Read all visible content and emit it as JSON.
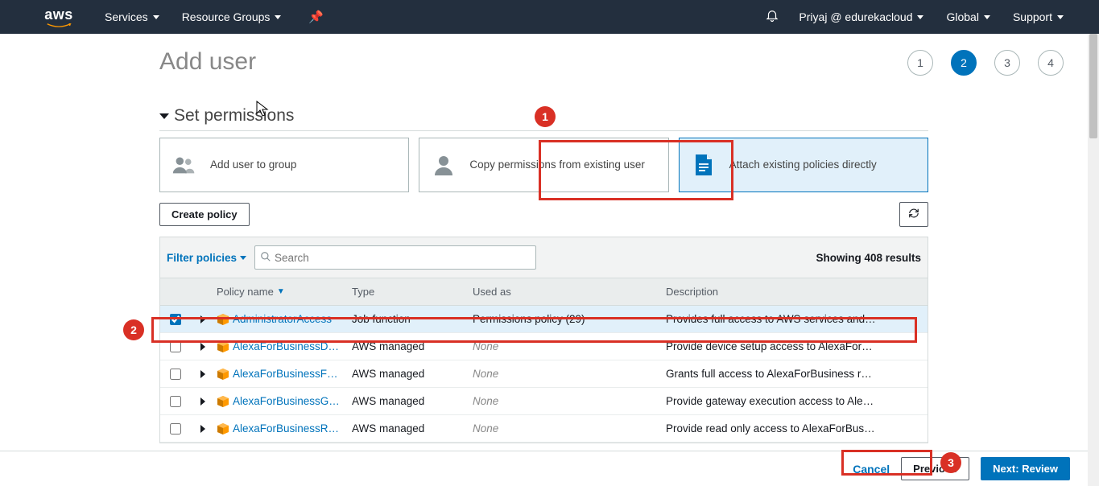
{
  "nav": {
    "services": "Services",
    "resource_groups": "Resource Groups",
    "account": "Priyaj @ edurekacloud",
    "region": "Global",
    "support": "Support"
  },
  "page": {
    "title": "Add user",
    "steps": [
      "1",
      "2",
      "3",
      "4"
    ],
    "active_step": 1
  },
  "section": {
    "title": "Set permissions"
  },
  "options": {
    "add_to_group": "Add user to group",
    "copy": "Copy permissions from existing user",
    "attach": "Attach existing policies directly"
  },
  "buttons": {
    "create_policy": "Create policy",
    "cancel": "Cancel",
    "previous": "Previous",
    "next": "Next: Review"
  },
  "filter": {
    "label": "Filter policies",
    "search_placeholder": "Search",
    "results": "Showing 408 results"
  },
  "columns": {
    "name": "Policy name",
    "type": "Type",
    "used": "Used as",
    "desc": "Description"
  },
  "rows": [
    {
      "checked": true,
      "name": "AdministratorAccess",
      "type": "Job function",
      "used": "Permissions policy (29)",
      "used_none": false,
      "desc": "Provides full access to AWS services and…"
    },
    {
      "checked": false,
      "name": "AlexaForBusinessD…",
      "type": "AWS managed",
      "used": "None",
      "used_none": true,
      "desc": "Provide device setup access to AlexaFor…"
    },
    {
      "checked": false,
      "name": "AlexaForBusinessF…",
      "type": "AWS managed",
      "used": "None",
      "used_none": true,
      "desc": "Grants full access to AlexaForBusiness r…"
    },
    {
      "checked": false,
      "name": "AlexaForBusinessG…",
      "type": "AWS managed",
      "used": "None",
      "used_none": true,
      "desc": "Provide gateway execution access to Ale…"
    },
    {
      "checked": false,
      "name": "AlexaForBusinessR…",
      "type": "AWS managed",
      "used": "None",
      "used_none": true,
      "desc": "Provide read only access to AlexaForBus…"
    }
  ],
  "annotations": {
    "one": "1",
    "two": "2",
    "three": "3"
  }
}
